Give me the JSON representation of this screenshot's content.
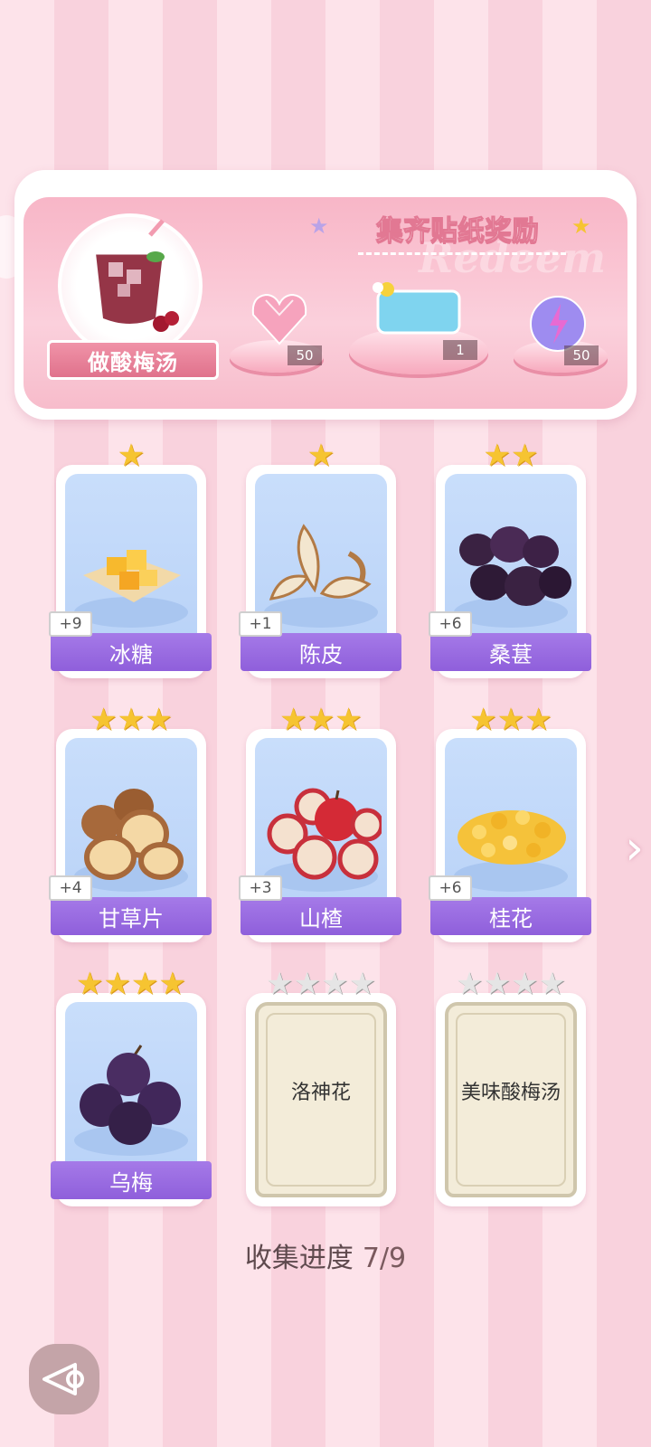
{
  "banner": {
    "drink_name": "做酸梅汤",
    "reward_title": "集齐贴纸奖励",
    "watermark": "Redeem",
    "rewards": [
      {
        "icon": "pink-heart-gem-icon",
        "count": "50"
      },
      {
        "icon": "blue-ticket-icon",
        "count": "1"
      },
      {
        "icon": "energy-orb-icon",
        "count": "50"
      }
    ]
  },
  "cards": [
    {
      "name": "冰糖",
      "bonus": "+9",
      "stars": 1,
      "icon": "rock-sugar-icon",
      "collected": true
    },
    {
      "name": "陈皮",
      "bonus": "+1",
      "stars": 1,
      "icon": "orange-peel-icon",
      "collected": true
    },
    {
      "name": "桑葚",
      "bonus": "+6",
      "stars": 2,
      "icon": "mulberry-icon",
      "collected": true
    },
    {
      "name": "甘草片",
      "bonus": "+4",
      "stars": 3,
      "icon": "licorice-slice-icon",
      "collected": true
    },
    {
      "name": "山楂",
      "bonus": "+3",
      "stars": 3,
      "icon": "hawthorn-icon",
      "collected": true
    },
    {
      "name": "桂花",
      "bonus": "+6",
      "stars": 3,
      "icon": "osmanthus-icon",
      "collected": true
    },
    {
      "name": "乌梅",
      "bonus": "",
      "stars": 4,
      "icon": "dark-plum-icon",
      "collected": true
    },
    {
      "name": "洛神花",
      "bonus": "",
      "stars": 4,
      "icon": "",
      "collected": false
    },
    {
      "name": "美味酸梅汤",
      "bonus": "",
      "stars": 4,
      "icon": "",
      "collected": false
    }
  ],
  "progress": {
    "label": "收集进度",
    "value": "7/9"
  },
  "colors": {
    "star_gold": "#f6c431",
    "name_bar": "#9b6ce2",
    "card_bg": "#c9defb",
    "locked_bg": "#f3ecd9"
  }
}
